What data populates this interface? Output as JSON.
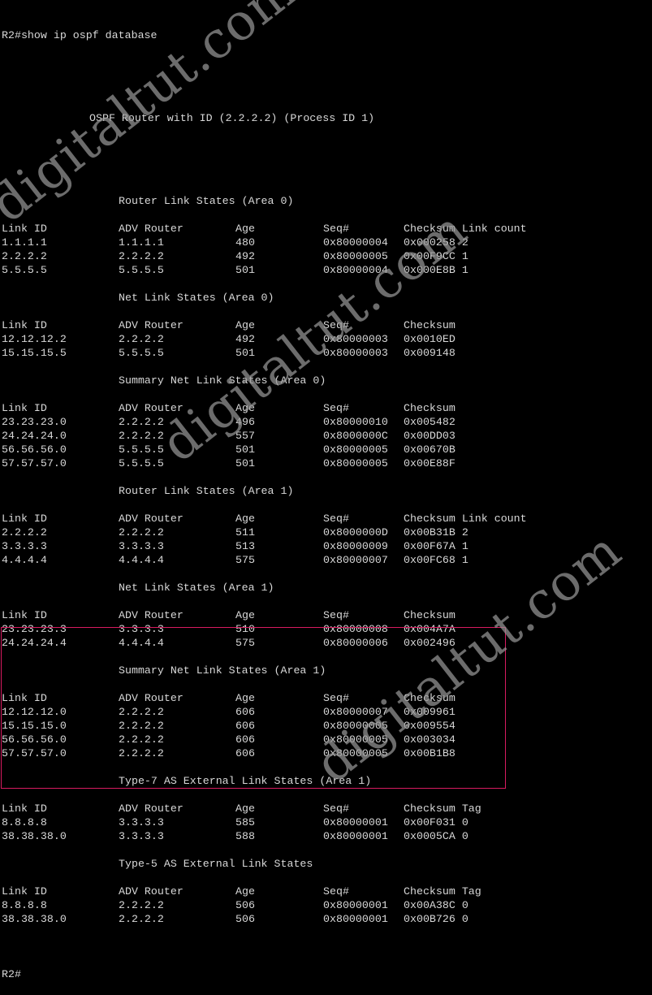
{
  "terminal": {
    "command_prompt": "R2#",
    "command": "show ip ospf database",
    "title": "OSPF Router with ID (2.2.2.2) (Process ID 1)",
    "final_prompt": "R2#",
    "highlight_color": "#d81b60",
    "text_color": "#d8d8d8",
    "background_color": "#000000"
  },
  "sections": [
    {
      "title": "Router Link States (Area 0)",
      "headers": [
        "Link ID",
        "ADV Router",
        "Age",
        "Seq#",
        "Checksum",
        "Link count"
      ],
      "rows": [
        [
          "1.1.1.1",
          "1.1.1.1",
          "480",
          "0x80000004",
          "0x000258",
          "2"
        ],
        [
          "2.2.2.2",
          "2.2.2.2",
          "492",
          "0x80000005",
          "0x00F9CC",
          "1"
        ],
        [
          "5.5.5.5",
          "5.5.5.5",
          "501",
          "0x80000004",
          "0x000E8B",
          "1"
        ]
      ]
    },
    {
      "title": "Net Link States (Area 0)",
      "headers": [
        "Link ID",
        "ADV Router",
        "Age",
        "Seq#",
        "Checksum"
      ],
      "rows": [
        [
          "12.12.12.2",
          "2.2.2.2",
          "492",
          "0x80000003",
          "0x0010ED"
        ],
        [
          "15.15.15.5",
          "5.5.5.5",
          "501",
          "0x80000003",
          "0x009148"
        ]
      ]
    },
    {
      "title": "Summary Net Link States (Area 0)",
      "headers": [
        "Link ID",
        "ADV Router",
        "Age",
        "Seq#",
        "Checksum"
      ],
      "rows": [
        [
          "23.23.23.0",
          "2.2.2.2",
          "496",
          "0x80000010",
          "0x005482"
        ],
        [
          "24.24.24.0",
          "2.2.2.2",
          "557",
          "0x8000000C",
          "0x00DD03"
        ],
        [
          "56.56.56.0",
          "5.5.5.5",
          "501",
          "0x80000005",
          "0x00670B"
        ],
        [
          "57.57.57.0",
          "5.5.5.5",
          "501",
          "0x80000005",
          "0x00E88F"
        ]
      ]
    },
    {
      "title": "Router Link States (Area 1)",
      "headers": [
        "Link ID",
        "ADV Router",
        "Age",
        "Seq#",
        "Checksum",
        "Link count"
      ],
      "rows": [
        [
          "2.2.2.2",
          "2.2.2.2",
          "511",
          "0x8000000D",
          "0x00B31B",
          "2"
        ],
        [
          "3.3.3.3",
          "3.3.3.3",
          "513",
          "0x80000009",
          "0x00F67A",
          "1"
        ],
        [
          "4.4.4.4",
          "4.4.4.4",
          "575",
          "0x80000007",
          "0x00FC68",
          "1"
        ]
      ]
    },
    {
      "title": "Net Link States (Area 1)",
      "headers": [
        "Link ID",
        "ADV Router",
        "Age",
        "Seq#",
        "Checksum"
      ],
      "rows": [
        [
          "23.23.23.3",
          "3.3.3.3",
          "510",
          "0x80000008",
          "0x004A7A"
        ],
        [
          "24.24.24.4",
          "4.4.4.4",
          "575",
          "0x80000006",
          "0x002496"
        ]
      ]
    },
    {
      "title": "Summary Net Link States (Area 1)",
      "headers": [
        "Link ID",
        "ADV Router",
        "Age",
        "Seq#",
        "Checksum"
      ],
      "rows": [
        [
          "12.12.12.0",
          "2.2.2.2",
          "606",
          "0x80000007",
          "0x009961"
        ],
        [
          "15.15.15.0",
          "2.2.2.2",
          "606",
          "0x80000005",
          "0x009554"
        ],
        [
          "56.56.56.0",
          "2.2.2.2",
          "606",
          "0x80000005",
          "0x003034"
        ],
        [
          "57.57.57.0",
          "2.2.2.2",
          "606",
          "0x80000005",
          "0x00B1B8"
        ]
      ]
    },
    {
      "title": "Type-7 AS External Link States (Area 1)",
      "headers": [
        "Link ID",
        "ADV Router",
        "Age",
        "Seq#",
        "Checksum",
        "Tag"
      ],
      "rows": [
        [
          "8.8.8.8",
          "3.3.3.3",
          "585",
          "0x80000001",
          "0x00F031",
          "0"
        ],
        [
          "38.38.38.0",
          "3.3.3.3",
          "588",
          "0x80000001",
          "0x0005CA",
          "0"
        ]
      ]
    },
    {
      "title": "Type-5 AS External Link States",
      "headers": [
        "Link ID",
        "ADV Router",
        "Age",
        "Seq#",
        "Checksum",
        "Tag"
      ],
      "rows": [
        [
          "8.8.8.8",
          "2.2.2.2",
          "506",
          "0x80000001",
          "0x00A38C",
          "0"
        ],
        [
          "38.38.38.0",
          "2.2.2.2",
          "506",
          "0x80000001",
          "0x00B726",
          "0"
        ]
      ]
    }
  ],
  "watermark": {
    "text": "digitaltut.com"
  }
}
